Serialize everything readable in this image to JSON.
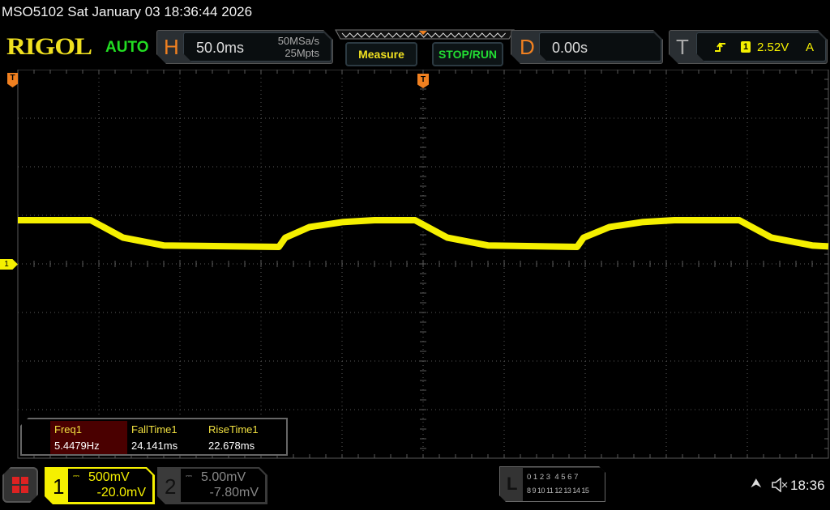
{
  "header": {
    "title": "MSO5102  Sat January 03 18:36:44 2026",
    "logo": "RIGOL",
    "mode": "AUTO"
  },
  "horizontal": {
    "letter": "H",
    "timebase": "50.0ms",
    "sample_rate": "50MSa/s",
    "memory_depth": "25Mpts"
  },
  "buttons": {
    "measure": "Measure",
    "stop_run": "STOP/RUN"
  },
  "delay": {
    "letter": "D",
    "value": "0.00s"
  },
  "trigger": {
    "letter": "T",
    "slope_icon": "rising-edge-icon",
    "source": "1",
    "level": "2.52V",
    "sweep": "A"
  },
  "markers": {
    "trigger_pos": "T",
    "ch1": "1",
    "left": "T"
  },
  "measurements": [
    {
      "name": "Freq1",
      "value": "5.4479Hz"
    },
    {
      "name": "FallTime1",
      "value": "24.141ms"
    },
    {
      "name": "RiseTime1",
      "value": "22.678ms"
    }
  ],
  "channels": [
    {
      "num": "1",
      "scale": "500mV",
      "offset": "-20.0mV",
      "coupling_icon": "dc-coupling-icon",
      "color": "#f5f000",
      "active": true
    },
    {
      "num": "2",
      "scale": "5.00mV",
      "offset": "-7.80mV",
      "coupling_icon": "dc-coupling-icon",
      "color": "#888888",
      "active": false
    }
  ],
  "logic": {
    "letter": "L",
    "row1": "0 1 2 3  4 5 6 7",
    "row2": "8 9 10 11 12 13 14 15"
  },
  "status": {
    "usb_icon": "usb-icon",
    "sound_icon": "mute-icon",
    "time": "18:36"
  },
  "colors": {
    "ch1": "#f5f000",
    "accent": "#f08020",
    "grid": "#5a5a5a"
  },
  "chart_data": {
    "type": "line",
    "xlabel": "",
    "ylabel": "",
    "x_units": "ms",
    "y_units": "V",
    "xlim": [
      -250,
      250
    ],
    "ylim": [
      -2.0,
      2.0
    ],
    "x_div": "50ms",
    "y_div": "500mV",
    "grid": true,
    "series": [
      {
        "points": [
          [
            -250,
            0.45
          ],
          [
            -205,
            0.45
          ],
          [
            -185,
            0.27
          ],
          [
            -160,
            0.19
          ],
          [
            -89,
            0.175
          ],
          [
            -85,
            0.27
          ],
          [
            -70,
            0.38
          ],
          [
            -50,
            0.43
          ],
          [
            -30,
            0.45
          ],
          [
            -5,
            0.45
          ],
          [
            15,
            0.27
          ],
          [
            40,
            0.19
          ],
          [
            95,
            0.175
          ],
          [
            99,
            0.27
          ],
          [
            115,
            0.38
          ],
          [
            135,
            0.43
          ],
          [
            155,
            0.45
          ],
          [
            195,
            0.45
          ],
          [
            215,
            0.27
          ],
          [
            240,
            0.19
          ],
          [
            250,
            0.18
          ]
        ]
      }
    ]
  }
}
